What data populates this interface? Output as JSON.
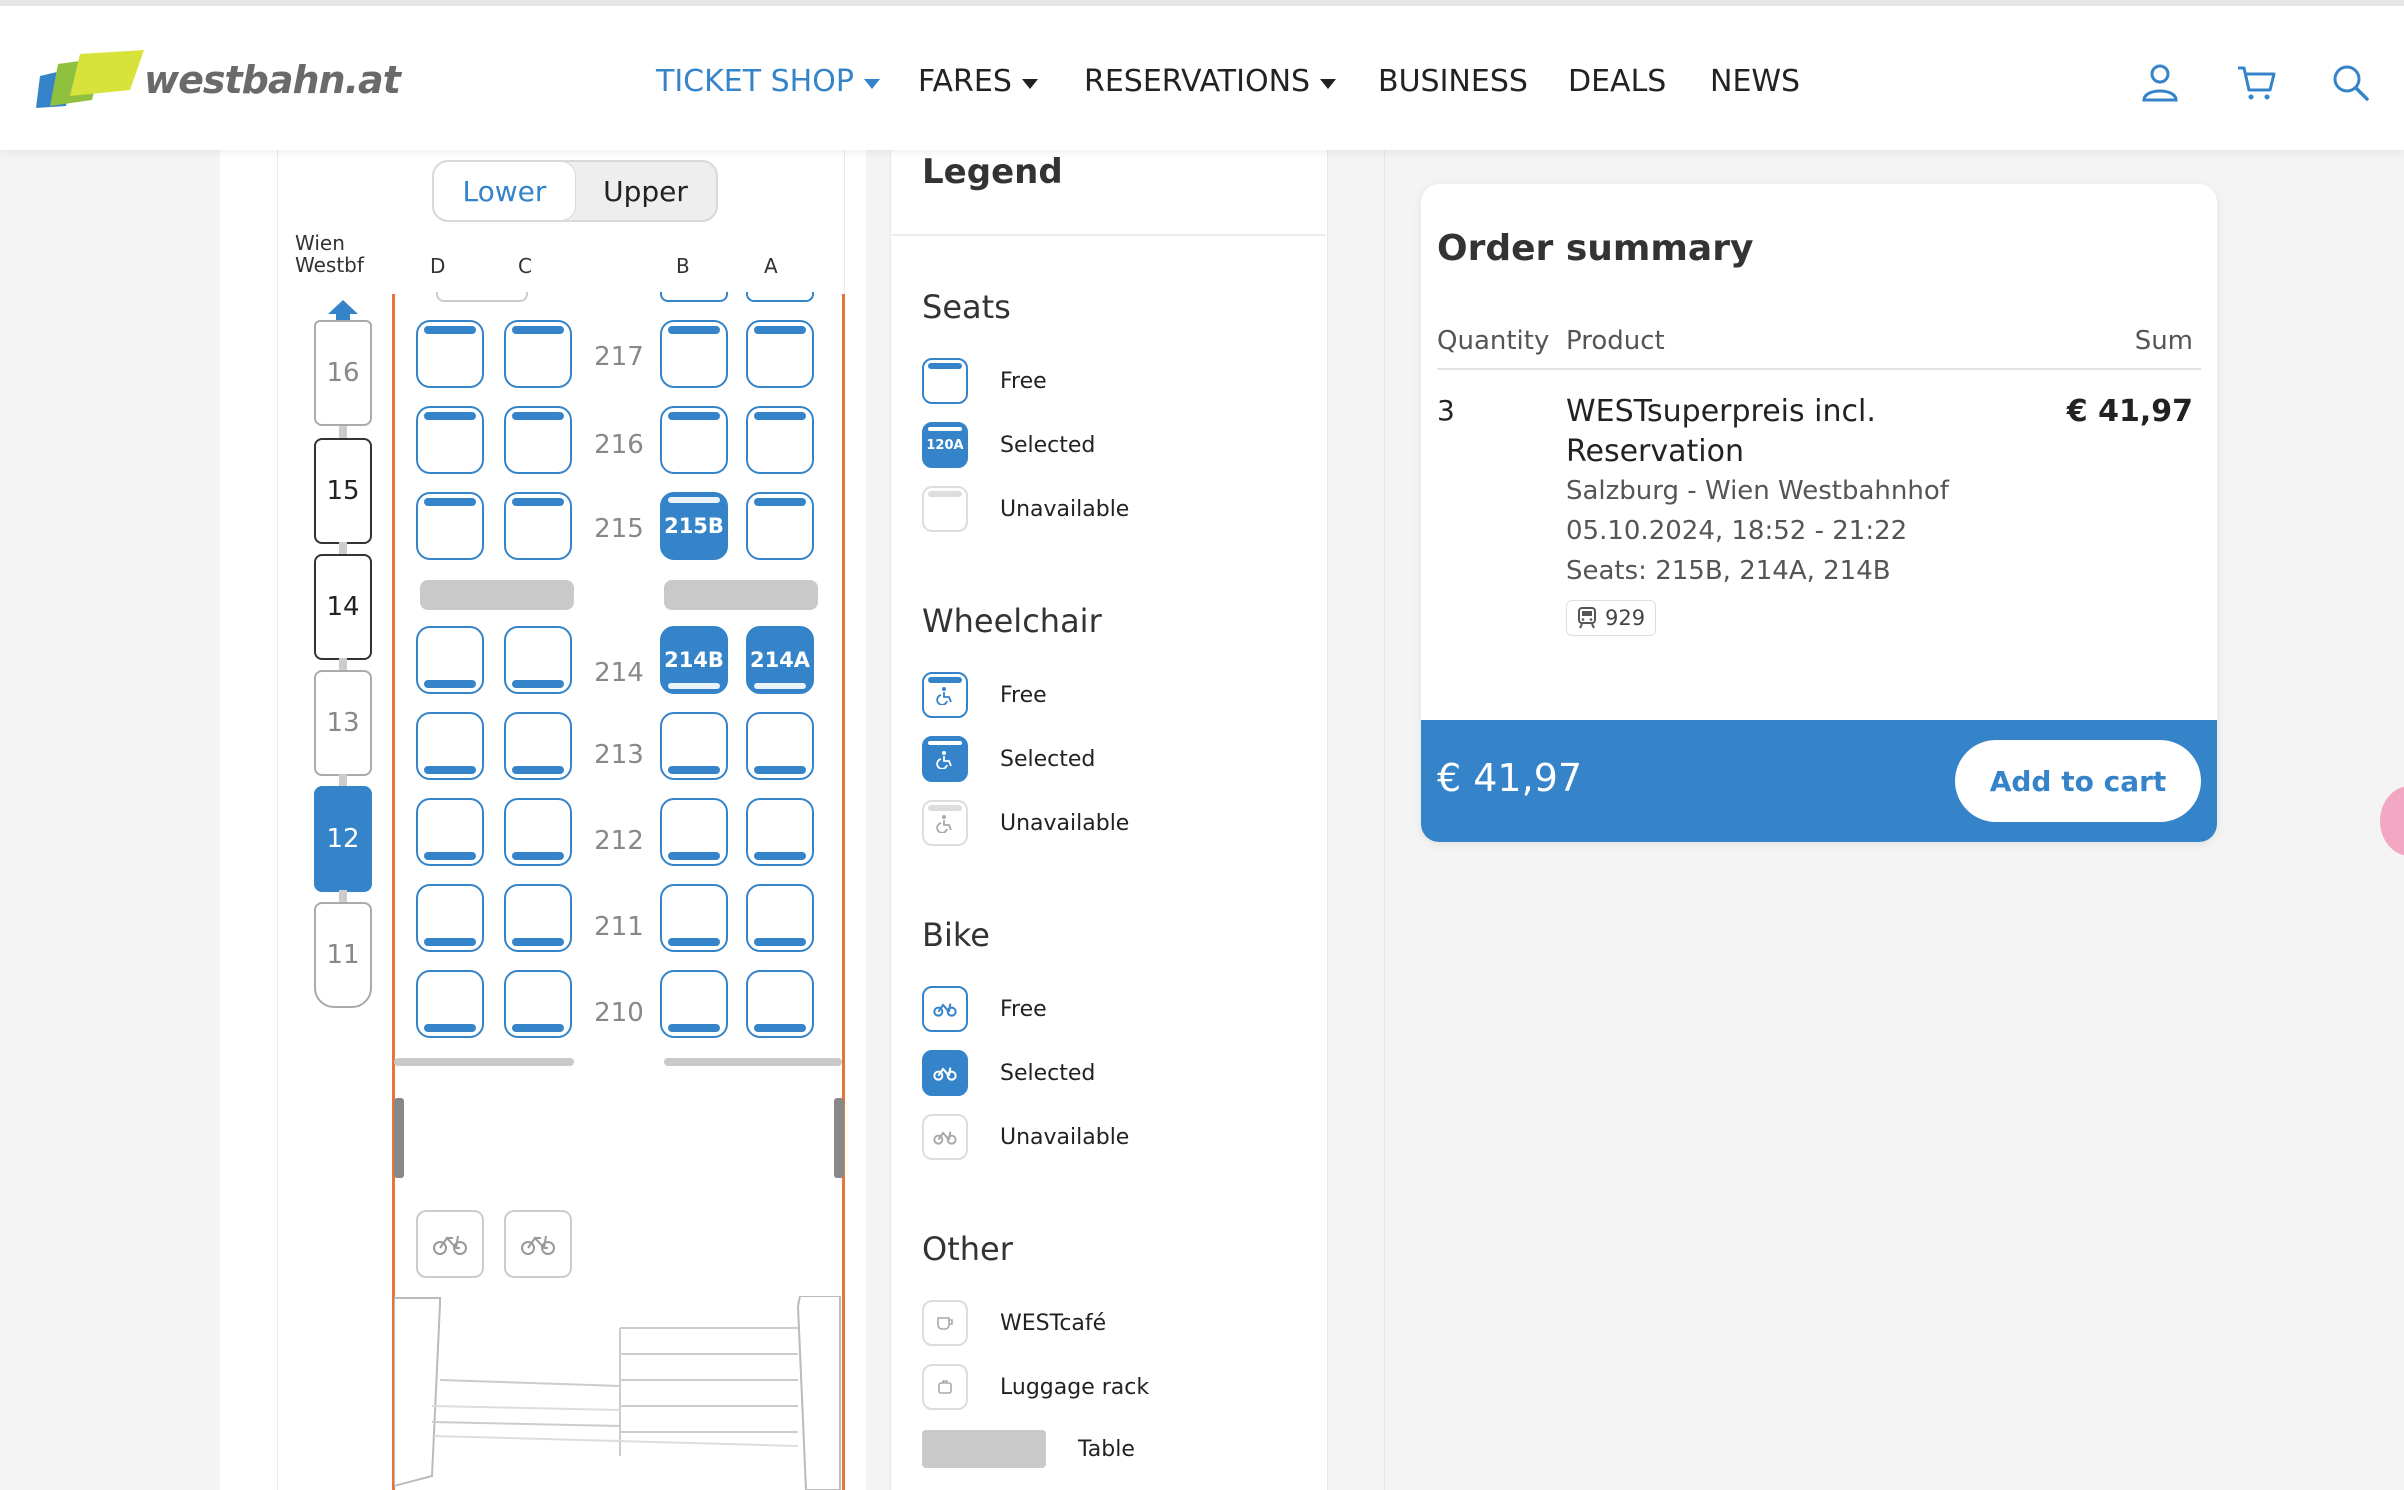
{
  "header": {
    "logo_text": "westbahn.at",
    "nav": [
      {
        "label": "TICKET SHOP",
        "dropdown": true,
        "active": true
      },
      {
        "label": "FARES",
        "dropdown": true,
        "active": false
      },
      {
        "label": "RESERVATIONS",
        "dropdown": true,
        "active": false
      },
      {
        "label": "BUSINESS",
        "dropdown": false,
        "active": false
      },
      {
        "label": "DEALS",
        "dropdown": false,
        "active": false
      },
      {
        "label": "NEWS",
        "dropdown": false,
        "active": false
      }
    ],
    "icons": [
      "user-icon",
      "cart-icon",
      "search-icon"
    ]
  },
  "deck": {
    "toggle": {
      "lower": "Lower",
      "upper": "Upper",
      "selected": "Lower"
    },
    "origin": "Wien Westbf",
    "columns": [
      "D",
      "C",
      "B",
      "A"
    ],
    "cars": [
      "16",
      "15",
      "14",
      "13",
      "12",
      "11"
    ],
    "active_car": "12",
    "rows": [
      "217",
      "216",
      "215",
      "214",
      "213",
      "212",
      "211",
      "210"
    ],
    "selected_seats": [
      "215B",
      "214B",
      "214A"
    ]
  },
  "legend": {
    "title": "Legend",
    "sections": {
      "seats": {
        "title": "Seats",
        "free": "Free",
        "selected": "Selected",
        "selected_sample": "120A",
        "unavailable": "Unavailable"
      },
      "wheelchair": {
        "title": "Wheelchair",
        "free": "Free",
        "selected": "Selected",
        "unavailable": "Unavailable"
      },
      "bike": {
        "title": "Bike",
        "free": "Free",
        "selected": "Selected",
        "unavailable": "Unavailable"
      },
      "other": {
        "title": "Other",
        "cafe": "WESTcafé",
        "luggage": "Luggage rack",
        "table": "Table"
      }
    }
  },
  "summary": {
    "title": "Order summary",
    "headers": {
      "quantity": "Quantity",
      "product": "Product",
      "sum": "Sum"
    },
    "item": {
      "quantity": "3",
      "product": "WESTsuperpreis incl. Reservation",
      "route": "Salzburg - Wien Westbahnhof",
      "datetime": "05.10.2024, 18:52 - 21:22",
      "seats": "Seats: 215B, 214A, 214B",
      "train": "929",
      "sum": "€ 41,97"
    },
    "total": "€ 41,97",
    "add_to_cart": "Add to cart"
  },
  "colors": {
    "accent": "#3584c9",
    "car_wall": "#e8743b",
    "table": "#c9c9c9"
  }
}
